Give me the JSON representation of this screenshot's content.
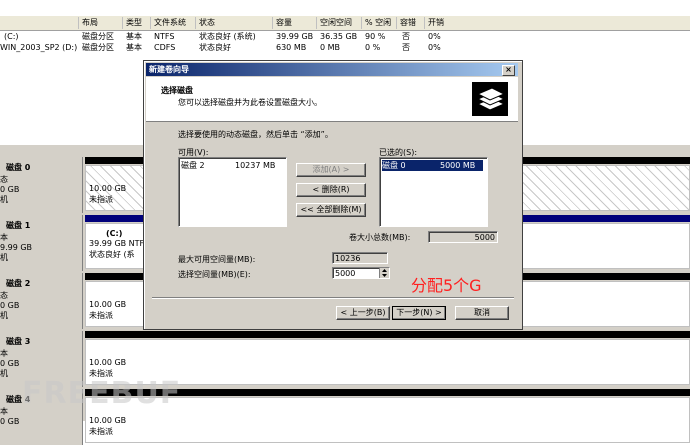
{
  "volume_table": {
    "columns": [
      "布局",
      "类型",
      "文件系统",
      "状态",
      "容量",
      "空闲空间",
      "% 空闲",
      "容错",
      "开销"
    ],
    "rows": [
      {
        "volume": "(C:)",
        "layout": "磁盘分区",
        "type": "基本",
        "fs": "NTFS",
        "status": "状态良好 (系统)",
        "capacity": "39.99 GB",
        "free": "36.35 GB",
        "pct_free": "90 %",
        "fault": "否",
        "overhead": "0%"
      },
      {
        "volume": "WIN_2003_SP2 (D:)",
        "layout": "磁盘分区",
        "type": "基本",
        "fs": "CDFS",
        "status": "状态良好",
        "capacity": "630 MB",
        "free": "0 MB",
        "pct_free": "0 %",
        "fault": "否",
        "overhead": "0%"
      }
    ]
  },
  "disks": [
    {
      "name": "磁盘 0",
      "label_lines": [
        "态",
        "0 GB",
        "机"
      ],
      "size": "10.00 GB",
      "state": "未指派"
    },
    {
      "name": "磁盘 1",
      "label_lines": [
        "本",
        "9.99 GB",
        "机"
      ],
      "volume": "(C:)",
      "size": "39.99 GB NTF",
      "state": "状态良好 (系"
    },
    {
      "name": "磁盘 2",
      "label_lines": [
        "态",
        "0 GB",
        "机"
      ],
      "size": "10.00 GB",
      "state": "未指派"
    },
    {
      "name": "磁盘 3",
      "label_lines": [
        "本",
        "0 GB",
        "机"
      ],
      "size": "10.00 GB",
      "state": "未指派"
    },
    {
      "name": "磁盘 4",
      "label_lines": [
        "本",
        "0 GB"
      ],
      "size": "10.00 GB",
      "state": "未指派"
    }
  ],
  "dialog": {
    "title": "新建卷向导",
    "header_title": "选择磁盘",
    "header_subtitle": "您可以选择磁盘并为此卷设置磁盘大小。",
    "instruction": "选择要使用的动态磁盘，然后单击 “添加”。",
    "available_label": "可用(V):",
    "available_items": [
      {
        "name": "磁盘 2",
        "size": "10237 MB"
      }
    ],
    "selected_label": "已选的(S):",
    "selected_items": [
      {
        "name": "磁盘 0",
        "size": "5000 MB"
      }
    ],
    "buttons": {
      "add": "添加(A) >",
      "remove": "< 删除(R)",
      "remove_all": "<< 全部删除(M)",
      "back": "< 上一步(B)",
      "next": "下一步(N) >",
      "cancel": "取消"
    },
    "total_size_label": "卷大小总数(MB):",
    "total_size_value": "5000",
    "max_space_label": "最大可用空间量(MB):",
    "max_space_value": "10236",
    "select_space_label": "选择空间量(MB)(E):",
    "select_space_value": "5000",
    "close_glyph": "×"
  },
  "annotation": "分配5个G",
  "watermark": "FREEBUF",
  "colors": {
    "title_start": "#0a246a",
    "title_end": "#a6caf0",
    "annotation": "#ff2020",
    "selection": "#0a246a"
  }
}
